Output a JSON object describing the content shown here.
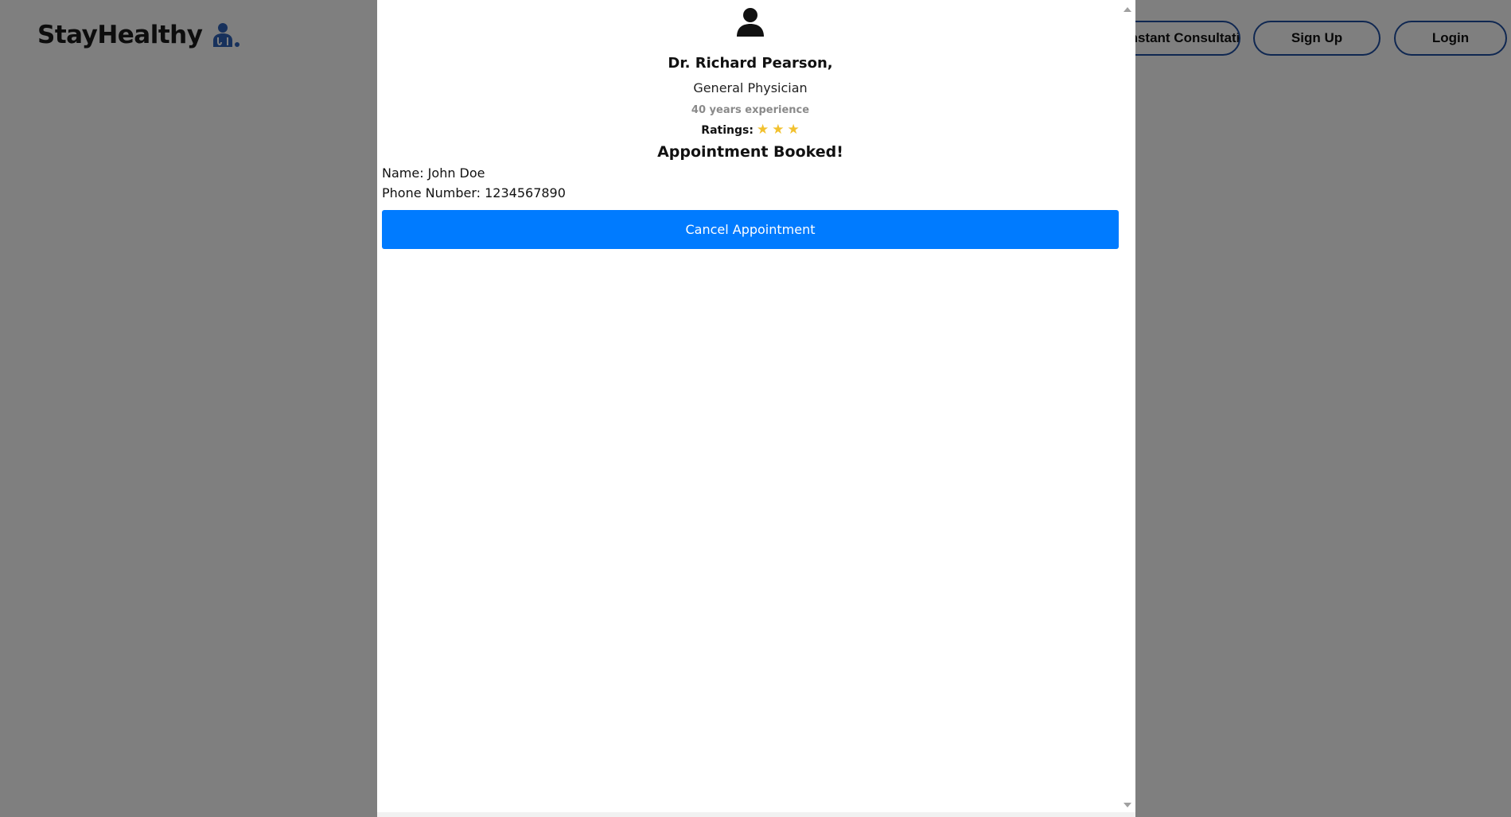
{
  "header": {
    "brand": "StayHealthy",
    "nav": {
      "consultation_label": "Instant Consultation",
      "signup_label": "Sign Up",
      "login_label": "Login"
    }
  },
  "modal": {
    "doctor": {
      "name": "Dr. Richard Pearson,",
      "speciality": "General Physician",
      "experience": "40 years experience",
      "ratings_label": "Ratings:",
      "stars": [
        "★",
        "★",
        "★"
      ]
    },
    "booked_title": "Appointment Booked!",
    "details": {
      "name": "Name: John Doe",
      "phone": "Phone Number: 1234567890"
    },
    "cancel_label": "Cancel Appointment"
  },
  "colors": {
    "accent": "#007bff",
    "nav_border": "#1f4fa3",
    "star": "#f2c12e",
    "brand_icon": "#2f63b8",
    "overlay": "rgba(0,0,0,0.5)"
  },
  "icons": {
    "brand": "doctor-logo-icon",
    "profile": "user-profile-icon",
    "star": "star-icon"
  }
}
